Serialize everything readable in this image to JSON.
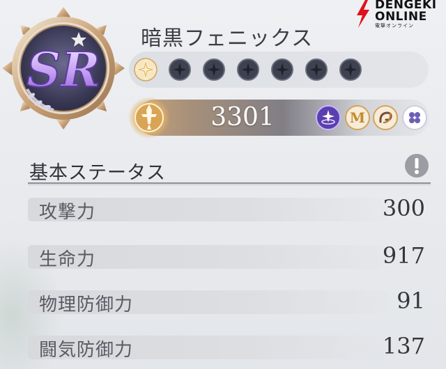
{
  "watermark": {
    "line1": "DENGEKI",
    "line2": "ONLINE",
    "sub": "電撃オンライン"
  },
  "unit": {
    "rarity": "SR",
    "name": "暗黒フェニックス",
    "stars_total": 7,
    "stars_filled": 1
  },
  "power": {
    "value": "3301"
  },
  "skill_icons": [
    "magic-orb-icon",
    "m-medal-icon",
    "swirl-icon",
    "clover-icon"
  ],
  "section": {
    "title": "基本ステータス"
  },
  "stats": [
    {
      "label": "攻撃力",
      "value": "300"
    },
    {
      "label": "生命力",
      "value": "917"
    },
    {
      "label": "物理防御力",
      "value": "91"
    },
    {
      "label": "闘気防御力",
      "value": "137"
    }
  ],
  "colors": {
    "gold": "#d8b06a",
    "purple": "#7b5cc9",
    "star_empty": "#3e4250",
    "text_dark": "#33363d"
  }
}
